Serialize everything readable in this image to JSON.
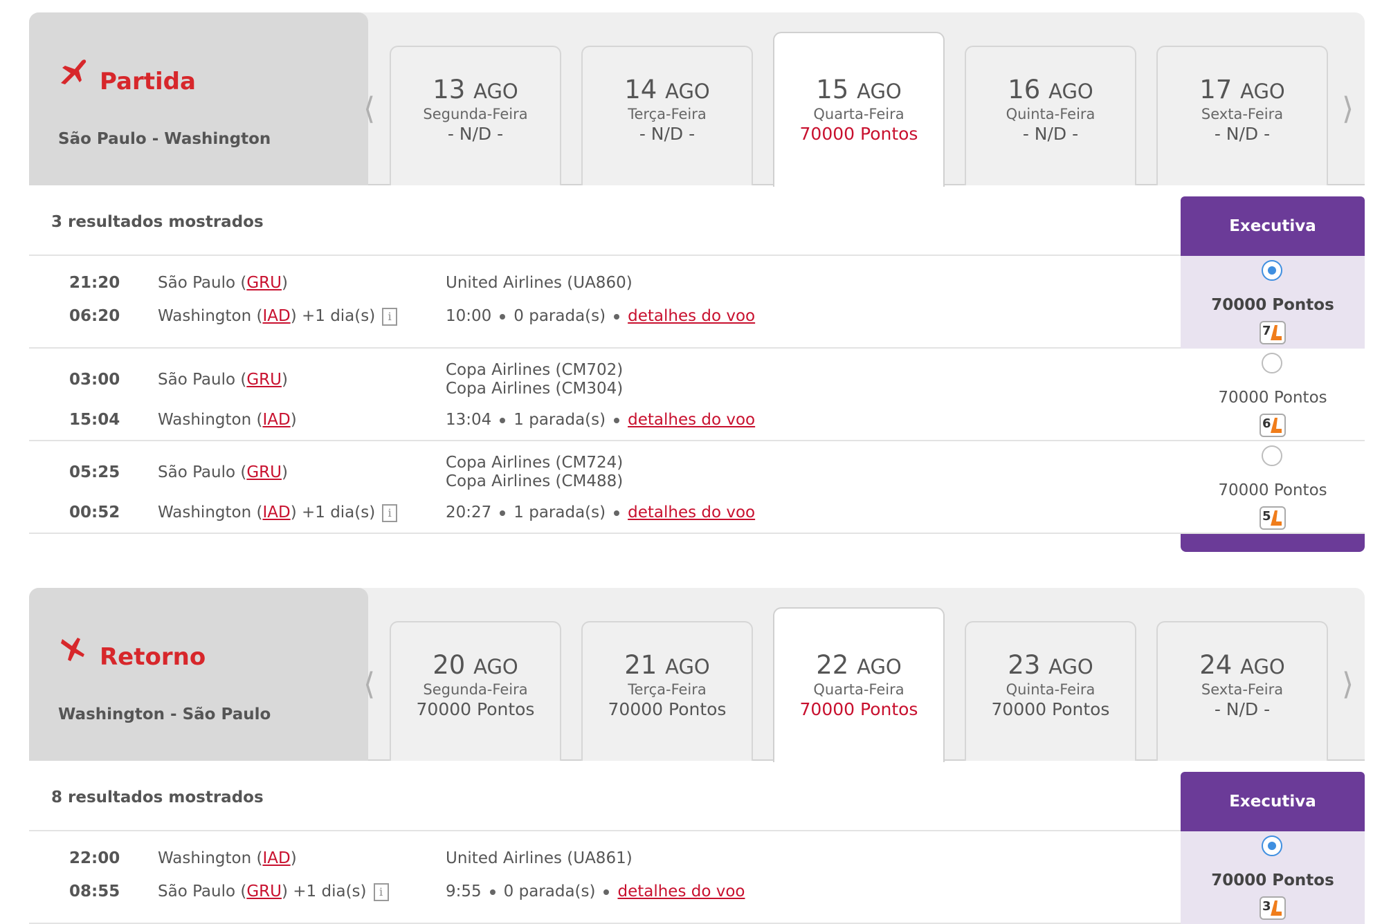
{
  "outbound": {
    "title": "Partida",
    "route": "São Paulo - Washington",
    "prev_arrow": "⟨",
    "next_arrow": "⟩",
    "dates": [
      {
        "day": "13",
        "month": "AGO",
        "weekday": "Segunda-Feira",
        "price": "- N/D -"
      },
      {
        "day": "14",
        "month": "AGO",
        "weekday": "Terça-Feira",
        "price": "- N/D -"
      },
      {
        "day": "15",
        "month": "AGO",
        "weekday": "Quarta-Feira",
        "price": "70000 Pontos"
      },
      {
        "day": "16",
        "month": "AGO",
        "weekday": "Quinta-Feira",
        "price": "- N/D -"
      },
      {
        "day": "17",
        "month": "AGO",
        "weekday": "Sexta-Feira",
        "price": "- N/D -"
      }
    ],
    "results_count": "3 resultados mostrados",
    "cabin": "Executiva",
    "flights": [
      {
        "dep_time": "21:20",
        "arr_time": "06:20",
        "dep_city": "São Paulo (",
        "dep_code": "GRU",
        "arr_city": "Washington (",
        "arr_code": "IAD",
        "plus_day": ") +1 dia(s)",
        "airline1": "United Airlines (UA860)",
        "airline2": "",
        "duration": "10:00",
        "stops": "0 parada(s)",
        "details": "detalhes do voo",
        "fare": "70000 Pontos",
        "seats": "7"
      },
      {
        "dep_time": "03:00",
        "arr_time": "15:04",
        "dep_city": "São Paulo (",
        "dep_code": "GRU",
        "arr_city": "Washington (",
        "arr_code": "IAD",
        "plus_day": ")",
        "airline1": "Copa Airlines (CM702)",
        "airline2": "Copa Airlines (CM304)",
        "duration": "13:04",
        "stops": "1 parada(s)",
        "details": "detalhes do voo",
        "fare": "70000 Pontos",
        "seats": "6"
      },
      {
        "dep_time": "05:25",
        "arr_time": "00:52",
        "dep_city": "São Paulo (",
        "dep_code": "GRU",
        "arr_city": "Washington (",
        "arr_code": "IAD",
        "plus_day": ") +1 dia(s)",
        "airline1": "Copa Airlines (CM724)",
        "airline2": "Copa Airlines (CM488)",
        "duration": "20:27",
        "stops": "1 parada(s)",
        "details": "detalhes do voo",
        "fare": "70000 Pontos",
        "seats": "5"
      }
    ]
  },
  "return": {
    "title": "Retorno",
    "route": "Washington - São Paulo",
    "prev_arrow": "⟨",
    "next_arrow": "⟩",
    "dates": [
      {
        "day": "20",
        "month": "AGO",
        "weekday": "Segunda-Feira",
        "price": "70000 Pontos"
      },
      {
        "day": "21",
        "month": "AGO",
        "weekday": "Terça-Feira",
        "price": "70000 Pontos"
      },
      {
        "day": "22",
        "month": "AGO",
        "weekday": "Quarta-Feira",
        "price": "70000 Pontos"
      },
      {
        "day": "23",
        "month": "AGO",
        "weekday": "Quinta-Feira",
        "price": "70000 Pontos"
      },
      {
        "day": "24",
        "month": "AGO",
        "weekday": "Sexta-Feira",
        "price": "- N/D -"
      }
    ],
    "results_count": "8 resultados mostrados",
    "cabin": "Executiva",
    "flights": [
      {
        "dep_time": "22:00",
        "arr_time": "08:55",
        "dep_city": "Washington (",
        "dep_code": "IAD",
        "arr_city": "São Paulo (",
        "arr_code": "GRU",
        "plus_day": ") +1 dia(s)",
        "airline1": "United Airlines (UA861)",
        "airline2": "",
        "duration": "9:55",
        "stops": "0 parada(s)",
        "details": "detalhes do voo",
        "fare": "70000 Pontos",
        "seats": "3"
      }
    ]
  },
  "close_paren": ")",
  "info_glyph": "i",
  "colors": {
    "accent_red": "#c8102e",
    "cabin_purple": "#6b3b98",
    "radio_blue": "#3f8fe0"
  }
}
